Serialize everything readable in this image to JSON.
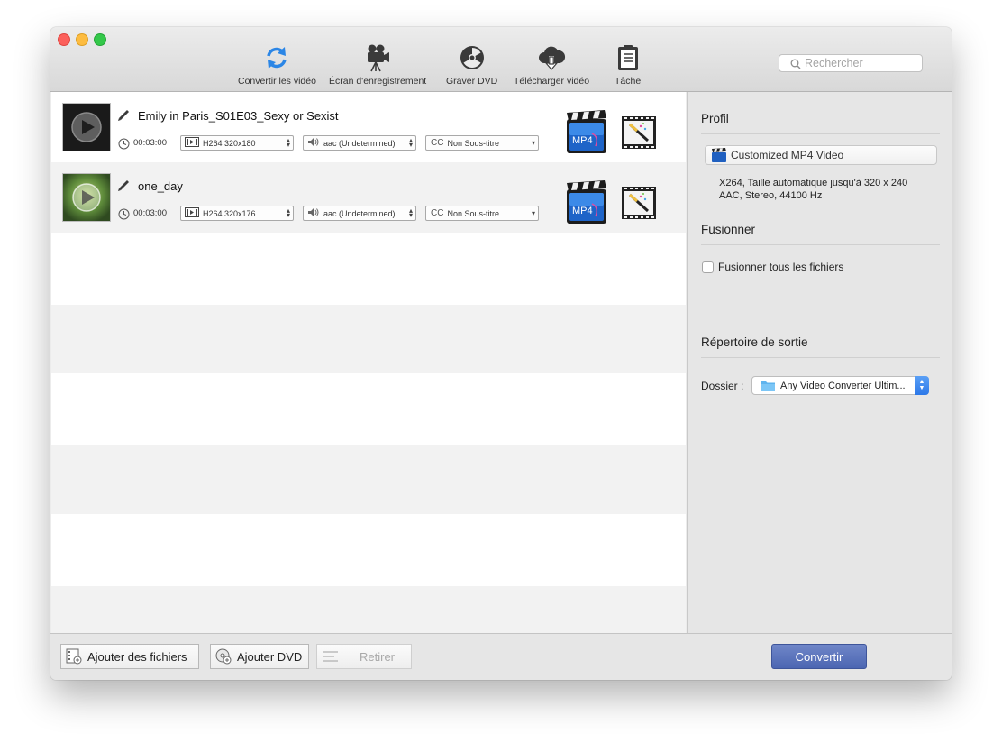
{
  "toolbar": {
    "items": [
      {
        "label": "Convertir les vidéo",
        "icon": "convert-icon"
      },
      {
        "label": "Écran d'enregistrement",
        "icon": "video-camera-icon"
      },
      {
        "label": "Graver DVD",
        "icon": "radiation-disc-icon"
      },
      {
        "label": "Télécharger vidéo",
        "icon": "cloud-download-icon"
      },
      {
        "label": "Tâche",
        "icon": "clipboard-icon"
      }
    ],
    "search_placeholder": "Rechercher"
  },
  "files": [
    {
      "name": "Emily in Paris_S01E03_Sexy or Sexist",
      "duration": "00:03:00",
      "video": "H264 320x180",
      "audio": "aac (Undetermined)",
      "subtitle": "Non Sous-titre",
      "subtitle_prefix": "CC"
    },
    {
      "name": "one_day",
      "duration": "00:03:00",
      "video": "H264 320x176",
      "audio": "aac (Undetermined)",
      "subtitle": "Non Sous-titre",
      "subtitle_prefix": "CC"
    }
  ],
  "format_badge": "MP4",
  "panel": {
    "profile_title": "Profil",
    "profile_value": "Customized MP4 Video",
    "profile_desc_1": "X264, Taille automatique jusqu'à 320 x 240",
    "profile_desc_2": "AAC, Stereo, 44100 Hz",
    "merge_title": "Fusionner",
    "merge_checkbox": "Fusionner tous les fichiers",
    "merge_checked": false,
    "output_title": "Répertoire de sortie",
    "folder_label": "Dossier :",
    "folder_value": "Any Video Converter Ultim..."
  },
  "bottom": {
    "add_files": "Ajouter des fichiers",
    "add_dvd": "Ajouter DVD",
    "remove": "Retirer",
    "convert": "Convertir"
  },
  "colors": {
    "accent": "#2b86e6",
    "convert_button": "#5a72bd"
  }
}
